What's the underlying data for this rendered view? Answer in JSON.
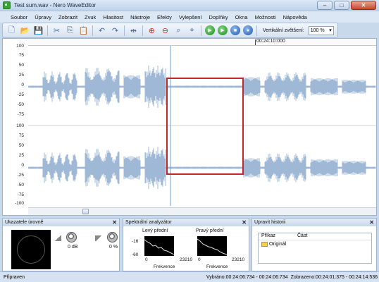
{
  "window": {
    "title": "Test sum.wav - Nero WaveEditor",
    "minimize": "–",
    "maximize": "□",
    "close": "✕"
  },
  "menu": [
    "Soubor",
    "Úpravy",
    "Zobrazit",
    "Zvuk",
    "Hlasitost",
    "Nástroje",
    "Efekty",
    "Vylepšení",
    "Doplňky",
    "Okna",
    "Možnosti",
    "Nápověda"
  ],
  "toolbar": {
    "zoom_label": "Vertikální zvětšení:",
    "zoom_value": "100 %",
    "icons": [
      "new-file-icon",
      "open-folder-icon",
      "save-icon",
      "cut-icon",
      "copy-icon",
      "paste-icon",
      "undo-icon",
      "redo-icon",
      "fit-icon",
      "zoom-in-icon",
      "zoom-out-icon",
      "zoom-selection-icon",
      "zoom-all-icon",
      "play-icon",
      "play-loop-icon",
      "stop-icon",
      "record-icon"
    ]
  },
  "editor": {
    "timeline_label": "00:24:10:000",
    "y_labels_top": [
      "100",
      "75",
      "50",
      "25",
      "0",
      "-25",
      "-50",
      "-75"
    ],
    "y_labels_bottom": [
      "100",
      "75",
      "50",
      "25",
      "0",
      "-25",
      "-50",
      "-75",
      "-100"
    ]
  },
  "panels": {
    "levels": {
      "title": "Ukazatele úrovně",
      "volume_label": "0 dB",
      "pan_label": "0 %"
    },
    "spectrum": {
      "title": "Spektrální analyzátor",
      "left_title": "Levý přední",
      "right_title": "Pravý přední",
      "y_top": "-16",
      "y_bottom": "-60",
      "x_min": "0",
      "x_max": "23210",
      "x_label": "Frekvence"
    },
    "history": {
      "title": "Upravit historii",
      "col_command": "Příkaz",
      "col_part": "Část",
      "rows": [
        "Originál"
      ]
    }
  },
  "status": {
    "ready": "Připraven",
    "selected": "Vybráno:00:24:06:734 - 00:24:06:734",
    "displayed": "Zobrazeno:00:24:01:375 - 00:24:14:536"
  },
  "colors": {
    "wave": "#9fb8d6",
    "selection": "#c0282a",
    "cursor": "#6aa4d8"
  }
}
